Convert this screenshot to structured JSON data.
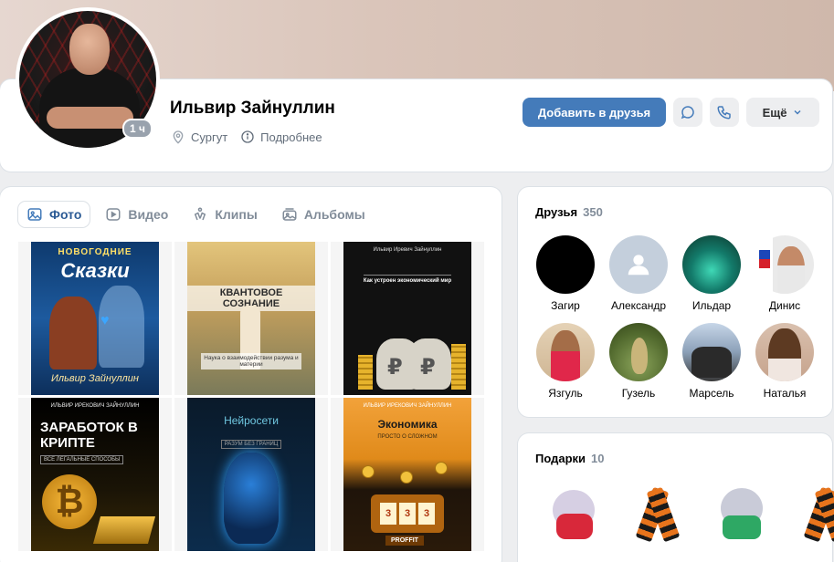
{
  "profile": {
    "name": "Ильвир Зайнуллин",
    "online_badge": "1 ч",
    "city": "Сургут",
    "details_label": "Подробнее"
  },
  "actions": {
    "add_friend_label": "Добавить в друзья",
    "more_label": "Ещё"
  },
  "media_tabs": [
    {
      "label": "Фото",
      "active": true
    },
    {
      "label": "Видео"
    },
    {
      "label": "Клипы"
    },
    {
      "label": "Альбомы"
    }
  ],
  "photos": [
    {
      "top": "НОВОГОДНИЕ",
      "title": "Сказки",
      "author": "Ильвир Зайнуллин"
    },
    {
      "title": "КВАНТОВОЕ СОЗНАНИЕ",
      "subtitle": "Наука о взаимодействии разума и материи"
    },
    {
      "author": "Ильвир Иревич Зайнуллин",
      "title": "Как устроен экономический мир"
    },
    {
      "author": "ИЛЬВИР ИРЕКОВИЧ ЗАЙНУЛЛИН",
      "title": "ЗАРАБОТОК В КРИПТЕ",
      "subtitle": "ВСЕ ЛЕГАЛЬНЫЕ СПОСОБЫ"
    },
    {
      "title": "Нейросети",
      "subtitle": "РАЗУМ БЕЗ ГРАНИЦ"
    },
    {
      "author": "ИЛЬВИР ИРЕКОВИЧ ЗАЙНУЛЛИН",
      "title": "Экономика",
      "subtitle": "ПРОСТО О СЛОЖНОМ",
      "badge": "PROFFIT"
    }
  ],
  "friends": {
    "title": "Друзья",
    "count": "350",
    "items": [
      {
        "name": "Загир"
      },
      {
        "name": "Александр"
      },
      {
        "name": "Ильдар"
      },
      {
        "name": "Динис"
      },
      {
        "name": "Язгуль"
      },
      {
        "name": "Гузель"
      },
      {
        "name": "Марсель"
      },
      {
        "name": "Наталья"
      }
    ]
  },
  "gifts": {
    "title": "Подарки",
    "count": "10",
    "items": [
      "hamster-gift-icon",
      "ribbon-gift-icon",
      "cat-gift-icon",
      "ribbon-gift-icon"
    ]
  },
  "colors": {
    "primary_button": "#447bba",
    "accent_text": "#2c5b95",
    "muted_text": "#818c99",
    "background": "#edeef0"
  }
}
